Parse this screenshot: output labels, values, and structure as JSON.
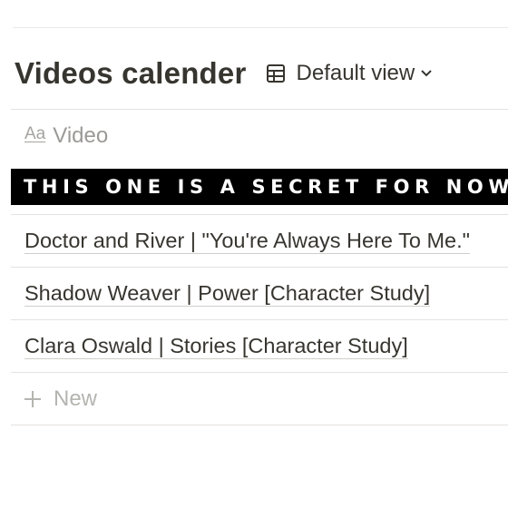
{
  "header": {
    "title": "Videos calender",
    "view_label": "Default view",
    "view_icon": "table-icon",
    "dropdown_icon": "chevron-down-icon"
  },
  "table": {
    "column_header": "Video",
    "column_icon_text": "Aa",
    "secret_banner": "THIS ONE IS A SECRET FOR NOW",
    "rows": [
      "Doctor and River | \"You're Always Here To Me.\"",
      "Shadow Weaver | Power [Character Study]",
      "Clara Oswald | Stories [Character Study]"
    ],
    "new_label": "New"
  },
  "colors": {
    "text": "#37352f",
    "muted": "#9b9a97",
    "divider": "#e3e2e0",
    "banner_bg": "#000000",
    "banner_text": "#ffffff"
  }
}
